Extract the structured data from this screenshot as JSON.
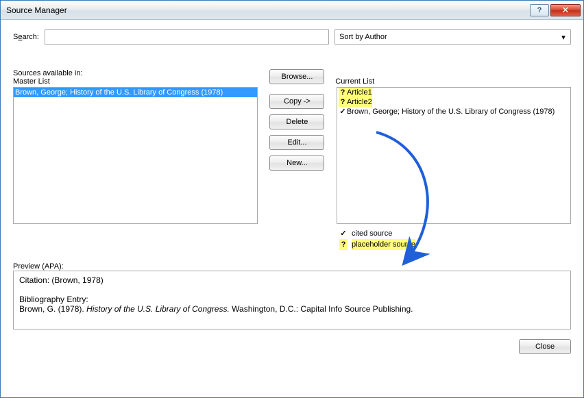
{
  "window": {
    "title": "Source Manager"
  },
  "search": {
    "label_pre": "S",
    "label_u": "e",
    "label_post": "arch:",
    "value": ""
  },
  "sort": {
    "selected": "Sort by Author"
  },
  "left_header_top": "Sources available in:",
  "left_header": "Master List",
  "browse_label": "Browse...",
  "master_items": [
    {
      "text": "Brown, George; History of the U.S. Library of Congress (1978)",
      "selected": true
    }
  ],
  "buttons": {
    "copy": "Copy ->",
    "delete": "Delete",
    "edit": "Edit...",
    "new": "New..."
  },
  "right_header": "Current List",
  "current_items": [
    {
      "marker": "?",
      "text": "Article1",
      "highlight": true
    },
    {
      "marker": "?",
      "text": "Article2",
      "highlight": true
    },
    {
      "marker": "✓",
      "text": "Brown, George; History of the U.S. Library of Congress (1978)",
      "highlight": false
    }
  ],
  "legend": {
    "cited_marker": "✓",
    "cited_label": "cited source",
    "placeholder_marker": "?",
    "placeholder_label": "placeholder source"
  },
  "preview_label": "Preview (APA):",
  "preview": {
    "citation_label": "Citation:",
    "citation_text": "(Brown, 1978)",
    "bib_label": "Bibliography Entry:",
    "bib_author": "Brown, G. (1978).",
    "bib_title": "History of the U.S. Library of Congress.",
    "bib_rest": "Washington, D.C.: Capital Info Source Publishing."
  },
  "close": "Close"
}
